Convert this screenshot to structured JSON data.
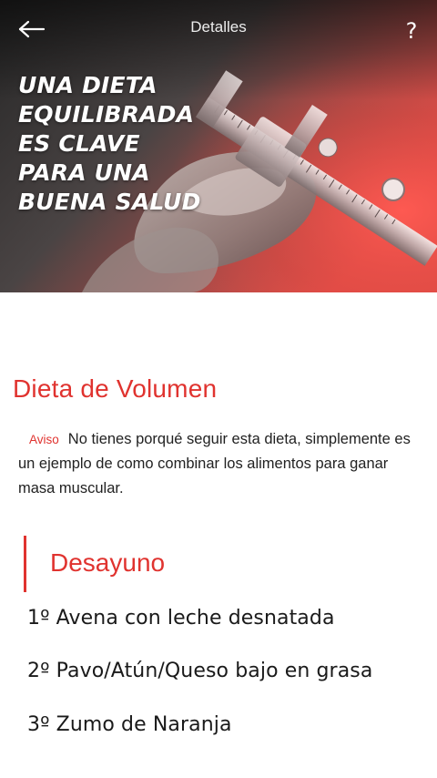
{
  "topbar": {
    "title": "Detalles",
    "help_label": "?"
  },
  "hero": {
    "title_lines": [
      "UNA DIETA",
      "EQUILIBRADA",
      "ES CLAVE",
      "PARA UNA",
      "BUENA SALUD"
    ]
  },
  "content": {
    "section_title": "Dieta de Volumen",
    "notice": {
      "badge": "Aviso",
      "text": "No tienes porqué seguir esta dieta, simplemente es un ejemplo de como combinar los alimentos para ganar masa muscular."
    },
    "meal": {
      "title": "Desayuno",
      "items": [
        "1º Avena con leche desnatada",
        "2º Pavo/Atún/Queso bajo en grasa",
        "3º Zumo de Naranja"
      ]
    }
  },
  "colors": {
    "accent": "#e0332f",
    "text": "#1a1a1a",
    "hero_overlay": "#e53935"
  },
  "icons": {
    "back": "arrow-left-icon",
    "help": "question-mark-icon",
    "hero_image": "caliper-measuring-skinfold-photo"
  }
}
